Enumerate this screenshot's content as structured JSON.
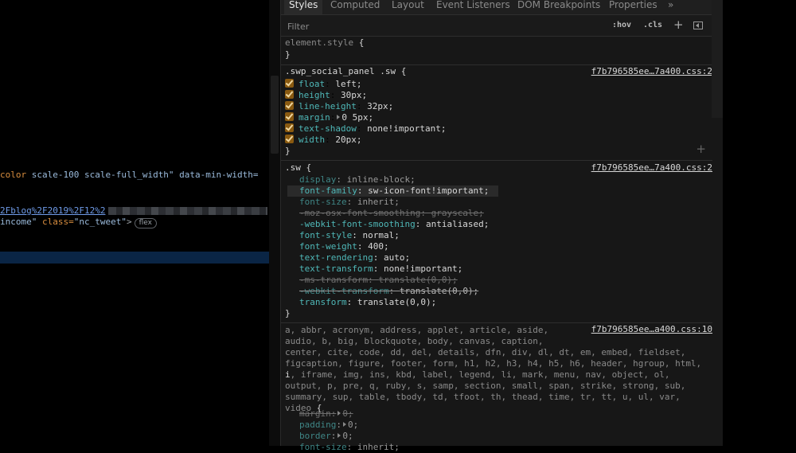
{
  "elements_panel": {
    "line1": {
      "attr": "color",
      "rest": "  scale-100 scale-full_width\" data-min-width="
    },
    "line2": {
      "link": "2Fblog%2F2019%2F12%2"
    },
    "line3": {
      "val": "income\"",
      "attr": " class=",
      "val2": "\"nc_tweet\"",
      "punc": ">",
      "badge": "flex"
    }
  },
  "tabs": [
    {
      "label": "Styles",
      "active": true
    },
    {
      "label": "Computed"
    },
    {
      "label": "Layout"
    },
    {
      "label": "Event Listeners"
    },
    {
      "label": "DOM Breakpoints"
    },
    {
      "label": "Properties"
    },
    {
      "label": "»"
    }
  ],
  "filter": {
    "placeholder": "Filter",
    "hov": ":hov",
    "cls": ".cls",
    "plus": "+"
  },
  "rules": {
    "element_style": {
      "selector": "element.style",
      "open": " {",
      "close": "}"
    },
    "swp": {
      "selector": ".swp_social_panel .sw",
      "open": " {",
      "source": "f7b796585ee…7a400.css:2",
      "close": "}",
      "add": "+",
      "props": [
        {
          "name": "float",
          "value": "left;"
        },
        {
          "name": "height",
          "value": "30px;"
        },
        {
          "name": "line-height",
          "value": "32px;"
        },
        {
          "name": "margin",
          "value": "0 5px;"
        },
        {
          "name": "text-shadow",
          "value": "none!important;"
        },
        {
          "name": "width",
          "value": "20px;"
        }
      ]
    },
    "sw": {
      "selector": ".sw",
      "open": " {",
      "source": "f7b796585ee…7a400.css:2",
      "close": "}",
      "props": [
        {
          "name": "display",
          "value": "inline-block;"
        },
        {
          "name": "font-family",
          "value": "sw-icon-font!important;"
        },
        {
          "name": "font-size",
          "value": "inherit;"
        },
        {
          "name": "-moz-osx-font-smoothing",
          "value": "grayscale;"
        },
        {
          "name": "-webkit-font-smoothing",
          "value": "antialiased;"
        },
        {
          "name": "font-style",
          "value": "normal;"
        },
        {
          "name": "font-weight",
          "value": "400;"
        },
        {
          "name": "text-rendering",
          "value": "auto;"
        },
        {
          "name": "text-transform",
          "value": "none!important;"
        },
        {
          "name": "-ms-transform",
          "value": "translate(0,0);"
        },
        {
          "name": "-webkit-transform",
          "value": "translate(0,0);"
        },
        {
          "name": "transform",
          "value": "translate(0,0);"
        }
      ]
    },
    "reset": {
      "source": "f7b796585ee…a400.css:10",
      "lines": [
        "a, abbr, acronym, address, applet, article, aside,",
        "audio, b, big, blockquote, body, canvas, caption,",
        "center, cite, code, dd, del, details, dfn, div, dl, dt, em, embed, fieldset,",
        "figcaption, figure, footer, form, h1, h2, h3, h4, h5, h6, header, hgroup, html,",
        "i",
        ", iframe, img, ins, kbd, label, legend, li, mark, menu, nav, object, ol,",
        "output, p, pre, q, ruby, s, samp, section, small, span, strike, strong, sub,",
        "summary, sup, table, tbody, td, tfoot, th, thead, time, tr, tt, u, ul, var,",
        "video"
      ],
      "open": " {",
      "props": [
        {
          "name": "margin",
          "value": "0;"
        },
        {
          "name": "padding",
          "value": "0;"
        },
        {
          "name": "border",
          "value": "0;"
        },
        {
          "name": "font-size",
          "value": "inherit;"
        }
      ]
    }
  }
}
